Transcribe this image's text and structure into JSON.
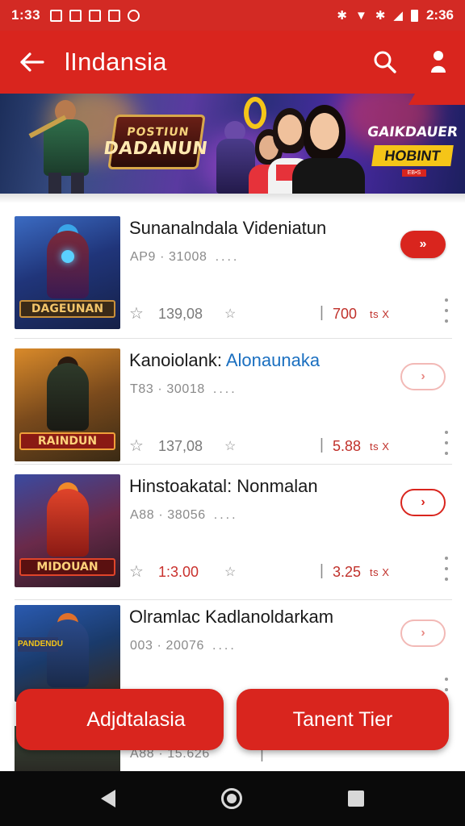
{
  "status_bar": {
    "time": "1:33",
    "clock": "2:36",
    "icons": [
      "image-notif-icon",
      "mail-notif-icon",
      "message-notif-icon",
      "photo-notif-icon",
      "radio-notif-icon",
      "bluetooth-icon",
      "wifi-icon",
      "bluetooth-icon",
      "signal-icon",
      "battery-icon"
    ]
  },
  "app_bar": {
    "title": "lIndansia",
    "back_icon": "arrow-left-icon",
    "search_icon": "search-icon",
    "profile_icon": "person-icon",
    "background": "#d9251e"
  },
  "banner": {
    "left_logo": [
      "POSTIUN",
      "DADANUN"
    ],
    "right_logo": [
      "GAIKDAUER",
      "HOBINT",
      "EB•S"
    ]
  },
  "apps": [
    {
      "title": "Sunanalndala Videniatun",
      "title_highlight": "",
      "subtitle": "AP9 · 31008",
      "rating": "139,08",
      "rating_red": false,
      "price": "700",
      "unit": "ts X",
      "thumb_caption": "DAGEUNAN",
      "play_style": "filled",
      "play_glyph": "»"
    },
    {
      "title": "Kanoiolank: ",
      "title_highlight": "Alonaunaka",
      "subtitle": "T83 · 30018",
      "rating": "137,08",
      "rating_red": false,
      "price": "5.88",
      "unit": "ts X",
      "thumb_caption": "RAINDUN",
      "play_style": "outline",
      "play_glyph": "›"
    },
    {
      "title": "Hinstoakatal: Nonmalan",
      "title_highlight": "",
      "subtitle": "A88 · 38056",
      "rating": "1:3.00",
      "rating_red": true,
      "price": "3.25",
      "unit": "ts X",
      "thumb_caption": "MIDOUAN",
      "play_style": "outline-strong",
      "play_glyph": "›"
    },
    {
      "title": "Olramlac Kadlanoldarkam",
      "title_highlight": "",
      "subtitle": "003 · 20076",
      "rating": "",
      "rating_red": false,
      "price": "",
      "unit": "",
      "thumb_caption": "PANDENDU",
      "play_style": "outline",
      "play_glyph": "›"
    },
    {
      "title": "",
      "title_highlight": "",
      "subtitle": "A88 · 15.626",
      "rating": "",
      "rating_red": false,
      "price": "",
      "unit": "",
      "thumb_caption": "",
      "play_style": "none",
      "play_glyph": ""
    }
  ],
  "fab": {
    "left_label": "Adjdtalasia",
    "right_label": "Tanent Tier"
  },
  "nav": {
    "back_icon": "nav-back-icon",
    "home_icon": "nav-home-icon",
    "recents_icon": "nav-recents-icon"
  },
  "colors": {
    "primary": "#d9251e",
    "status_bar": "#d32a24",
    "link_blue": "#1a6fc0"
  }
}
